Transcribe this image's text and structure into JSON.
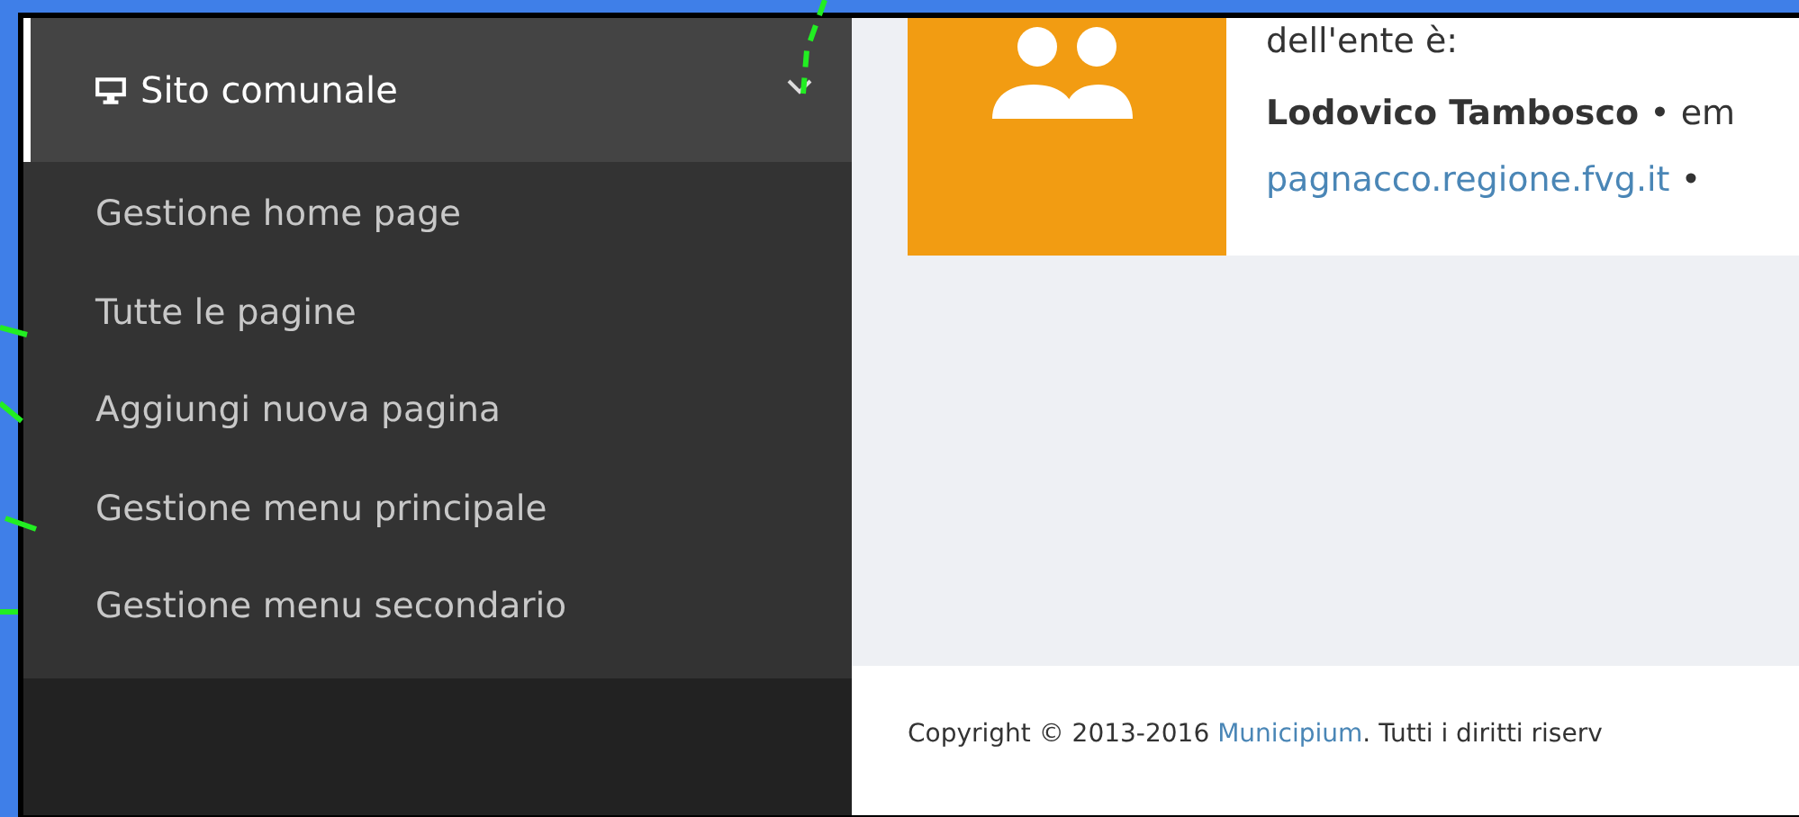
{
  "sidebar": {
    "section": {
      "label": "Sito comunale",
      "expanded": true,
      "selected": true
    },
    "items": [
      {
        "label": "Gestione home page"
      },
      {
        "label": "Tutte le pagine"
      },
      {
        "label": "Aggiungi nuova pagina"
      },
      {
        "label": "Gestione menu principale"
      },
      {
        "label": "Gestione menu secondario"
      }
    ]
  },
  "card": {
    "text": "dell'ente è:",
    "name": "Lodovico Tambosco",
    "after_name": "• em",
    "link": "pagnacco.regione.fvg.it",
    "after_link": "•"
  },
  "footer": {
    "prefix": "Copyright © 2013-2016",
    "link": "Municipium",
    "suffix": ". Tutti i diritti riserv"
  }
}
